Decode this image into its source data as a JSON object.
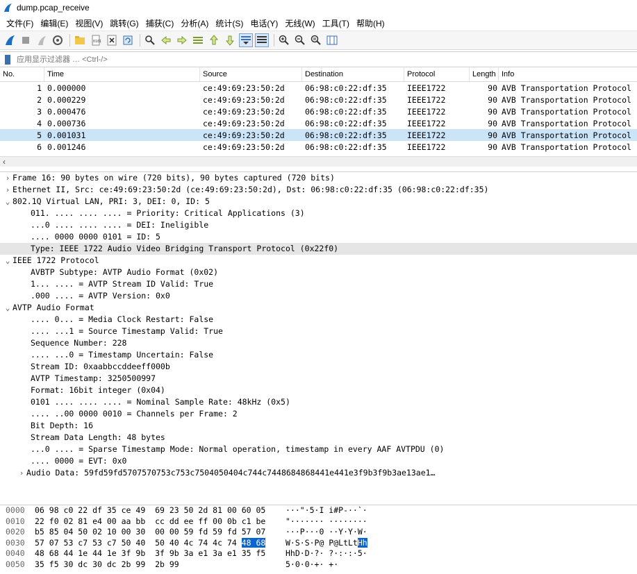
{
  "window": {
    "title": "dump.pcap_receive"
  },
  "menu": [
    "文件(F)",
    "编辑(E)",
    "视图(V)",
    "跳转(G)",
    "捕获(C)",
    "分析(A)",
    "统计(S)",
    "电话(Y)",
    "无线(W)",
    "工具(T)",
    "帮助(H)"
  ],
  "filter": {
    "placeholder": "应用显示过滤器 … <Ctrl-/>"
  },
  "packet_list": {
    "columns": [
      "No.",
      "Time",
      "Source",
      "Destination",
      "Protocol",
      "Length",
      "Info"
    ],
    "rows": [
      {
        "no": "1",
        "time": "0.000000",
        "src": "ce:49:69:23:50:2d",
        "dst": "06:98:c0:22:df:35",
        "proto": "IEEE1722",
        "len": "90",
        "info": "AVB Transportation Protocol"
      },
      {
        "no": "2",
        "time": "0.000229",
        "src": "ce:49:69:23:50:2d",
        "dst": "06:98:c0:22:df:35",
        "proto": "IEEE1722",
        "len": "90",
        "info": "AVB Transportation Protocol"
      },
      {
        "no": "3",
        "time": "0.000476",
        "src": "ce:49:69:23:50:2d",
        "dst": "06:98:c0:22:df:35",
        "proto": "IEEE1722",
        "len": "90",
        "info": "AVB Transportation Protocol"
      },
      {
        "no": "4",
        "time": "0.000736",
        "src": "ce:49:69:23:50:2d",
        "dst": "06:98:c0:22:df:35",
        "proto": "IEEE1722",
        "len": "90",
        "info": "AVB Transportation Protocol"
      },
      {
        "no": "5",
        "time": "0.001031",
        "src": "ce:49:69:23:50:2d",
        "dst": "06:98:c0:22:df:35",
        "proto": "IEEE1722",
        "len": "90",
        "info": "AVB Transportation Protocol"
      },
      {
        "no": "6",
        "time": "0.001246",
        "src": "ce:49:69:23:50:2d",
        "dst": "06:98:c0:22:df:35",
        "proto": "IEEE1722",
        "len": "90",
        "info": "AVB Transportation Protocol"
      }
    ]
  },
  "details": [
    {
      "text": "Frame 16: 90 bytes on wire (720 bits), 90 bytes captured (720 bits)",
      "twisty": "›"
    },
    {
      "text": "Ethernet II, Src: ce:49:69:23:50:2d (ce:49:69:23:50:2d), Dst: 06:98:c0:22:df:35 (06:98:c0:22:df:35)",
      "twisty": "›"
    },
    {
      "text": "802.1Q Virtual LAN, PRI: 3, DEI: 0, ID: 5",
      "twisty": "⌄"
    },
    {
      "text": "011. .... .... .... = Priority: Critical Applications (3)",
      "twisty": ""
    },
    {
      "text": "...0 .... .... .... = DEI: Ineligible",
      "twisty": ""
    },
    {
      "text": ".... 0000 0000 0101 = ID: 5",
      "twisty": ""
    },
    {
      "text": "Type: IEEE 1722 Audio Video Bridging Transport Protocol (0x22f0)",
      "twisty": ""
    },
    {
      "text": "IEEE 1722 Protocol",
      "twisty": "⌄"
    },
    {
      "text": "AVBTP Subtype: AVTP Audio Format (0x02)",
      "twisty": ""
    },
    {
      "text": "1... .... = AVTP Stream ID Valid: True",
      "twisty": ""
    },
    {
      "text": ".000 .... = AVTP Version: 0x0",
      "twisty": ""
    },
    {
      "text": "AVTP Audio Format",
      "twisty": "⌄"
    },
    {
      "text": ".... 0... = Media Clock Restart: False",
      "twisty": ""
    },
    {
      "text": ".... ...1 = Source Timestamp Valid: True",
      "twisty": ""
    },
    {
      "text": "Sequence Number: 228",
      "twisty": ""
    },
    {
      "text": ".... ...0 = Timestamp Uncertain: False",
      "twisty": ""
    },
    {
      "text": "Stream ID: 0xaabbccddeeff000b",
      "twisty": ""
    },
    {
      "text": "AVTP Timestamp: 3250500997",
      "twisty": ""
    },
    {
      "text": "Format: 16bit integer (0x04)",
      "twisty": ""
    },
    {
      "text": "0101 .... .... .... = Nominal Sample Rate: 48kHz (0x5)",
      "twisty": ""
    },
    {
      "text": ".... ..00 0000 0010 = Channels per Frame: 2",
      "twisty": ""
    },
    {
      "text": "Bit Depth: 16",
      "twisty": ""
    },
    {
      "text": "Stream Data Length: 48 bytes",
      "twisty": ""
    },
    {
      "text": "...0 .... = Sparse Timestamp Mode: Normal operation, timestamp in every AAF AVTPDU (0)",
      "twisty": ""
    },
    {
      "text": ".... 0000 = EVT: 0x0",
      "twisty": ""
    },
    {
      "text": "Audio Data: 59fd59fd5707570753c753c7504050404c744c7448684868441e441e3f9b3f9b3ae13ae1…",
      "twisty": "›"
    }
  ],
  "bytes": [
    {
      "offset": "0000",
      "hex": "06 98 c0 22 df 35 ce 49  69 23 50 2d 81 00 60 05",
      "ascii": "···\"·5·I i#P-··`·"
    },
    {
      "offset": "0010",
      "hex": "22 f0 02 81 e4 00 aa bb  cc dd ee ff 00 0b c1 be",
      "ascii": "\"······· ········"
    },
    {
      "offset": "0020",
      "hex": "b5 85 04 50 02 10 00 30  00 00 59 fd 59 fd 57 07",
      "ascii": "···P···0 ··Y·Y·W·"
    },
    {
      "offset": "0030",
      "hex": "57 07 53 c7 53 c7 50 40  50 40 4c 74 4c 74 ",
      "hex_sel": "48 68",
      "ascii": "W·S·S·P@ P@LtLt",
      "ascii_sel": "Hh"
    },
    {
      "offset": "0040",
      "hex": "48 68 44 1e 44 1e 3f 9b  3f 9b 3a e1 3a e1 35 f5",
      "ascii": "HhD·D·?· ?·:·:·5·"
    },
    {
      "offset": "0050",
      "hex": "35 f5 30 dc 30 dc 2b 99  2b 99",
      "ascii": "5·0·0·+· +·"
    }
  ]
}
